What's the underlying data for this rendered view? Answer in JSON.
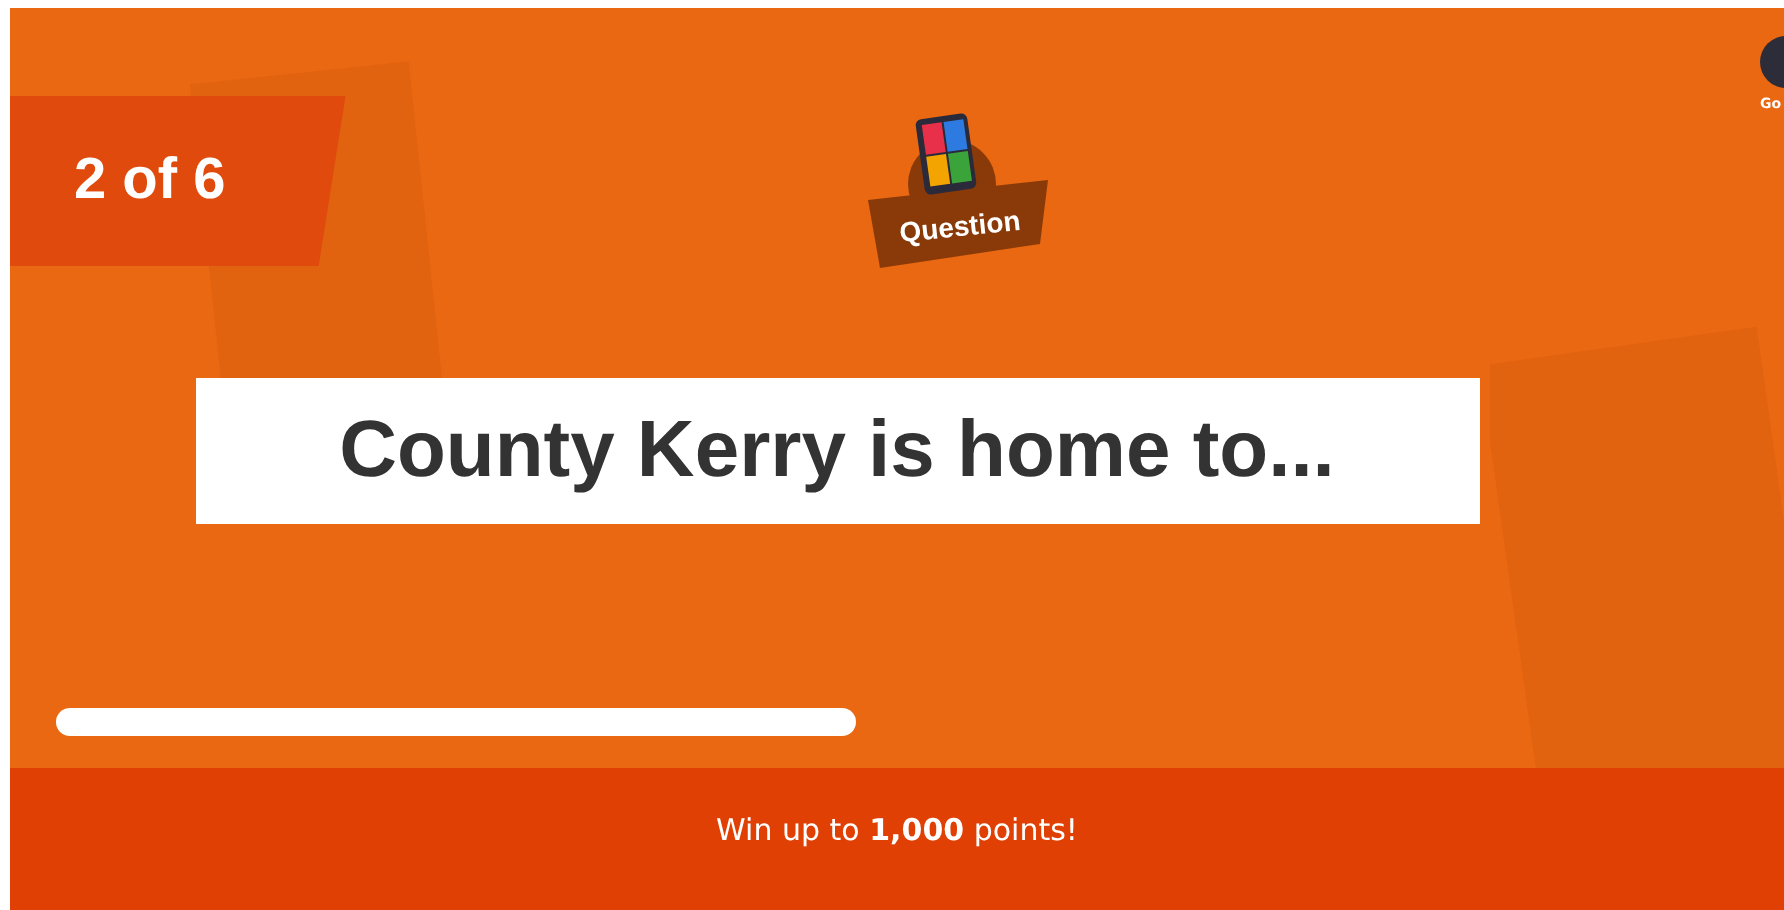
{
  "counter": "2 of 6",
  "category": {
    "label": "Question"
  },
  "corner": {
    "label": "Go"
  },
  "question": "County Kerry is home to...",
  "footer": "Win up to **1,000** points!"
}
